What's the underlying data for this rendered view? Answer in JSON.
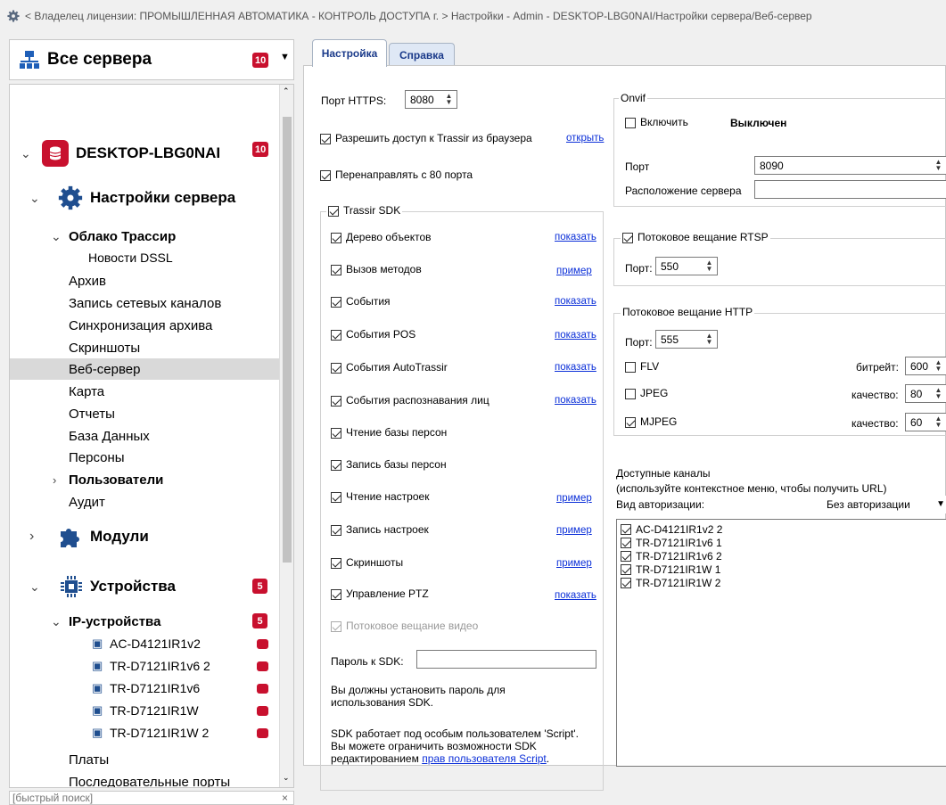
{
  "breadcrumb": "< Владелец лицензии: ПРОМЫШЛЕННАЯ АВТОМАТИКА - КОНТРОЛЬ ДОСТУПА г. > Настройки - Admin - DESKTOP-LBG0NAI/Настройки сервера/Веб-сервер",
  "left": {
    "all_servers": "Все сервера",
    "all_servers_badge": "10",
    "server_name": "DESKTOP-LBG0NAI",
    "server_badge": "10",
    "server_settings": "Настройки сервера",
    "cloud": "Облако Трассир",
    "news": "Новости DSSL",
    "items": [
      "Архив",
      "Запись сетевых каналов",
      "Синхронизация архива",
      "Скриншоты",
      "Веб-сервер",
      "Карта",
      "Отчеты",
      "База Данных",
      "Персоны"
    ],
    "users": "Пользователи",
    "audit": "Аудит",
    "modules": "Модули",
    "devices": "Устройства",
    "devices_badge": "5",
    "ip_devices": "IP-устройства",
    "ip_badge": "5",
    "cameras": [
      "AC-D4121IR1v2",
      "TR-D7121IR1v6 2",
      "TR-D7121IR1v6",
      "TR-D7121IR1W",
      "TR-D7121IR1W 2"
    ],
    "boards": "Платы",
    "serial": "Последовательные порты",
    "search_placeholder": "[быстрый поиск]",
    "search_clear": "×"
  },
  "tabs": {
    "settings": "Настройка",
    "help": "Справка"
  },
  "web": {
    "https_label": "Порт HTTPS:",
    "https_port": "8080",
    "allow_browser": "Разрешить доступ к Trassir из браузера",
    "open_link": "открыть",
    "redirect80": "Перенаправлять с 80 порта",
    "sdk_group": "Trassir SDK",
    "sdk_items": [
      {
        "label": "Дерево объектов",
        "link": "показать",
        "checked": true
      },
      {
        "label": "Вызов методов",
        "link": "пример",
        "checked": true
      },
      {
        "label": "События",
        "link": "показать",
        "checked": true
      },
      {
        "label": "События POS",
        "link": "показать",
        "checked": true
      },
      {
        "label": "События AutoTrassir",
        "link": "показать",
        "checked": true
      },
      {
        "label": "События распознавания лиц",
        "link": "показать",
        "checked": true
      },
      {
        "label": "Чтение базы персон",
        "link": "",
        "checked": true
      },
      {
        "label": "Запись базы персон",
        "link": "",
        "checked": true
      },
      {
        "label": "Чтение настроек",
        "link": "пример",
        "checked": true
      },
      {
        "label": "Запись настроек",
        "link": "пример",
        "checked": true
      },
      {
        "label": "Скриншоты",
        "link": "пример",
        "checked": true
      },
      {
        "label": "Управление PTZ",
        "link": "показать",
        "checked": true
      }
    ],
    "video_stream": "Потоковое вещание видео",
    "sdk_password_label": "Пароль к SDK:",
    "sdk_password_note": "Вы должны установить пароль для использования SDK.",
    "script_note_1": "SDK работает под особым пользователем 'Script'.",
    "script_note_2": "Вы можете ограничить возможности SDK",
    "script_note_3": "редактированием",
    "script_note_link": "прав пользователя Script"
  },
  "onvif": {
    "group": "Onvif",
    "enable": "Включить",
    "status": "Выключен",
    "port_label": "Порт",
    "port": "8090",
    "location_label": "Расположение сервера",
    "location": ""
  },
  "rtsp": {
    "group": "Потоковое вещание RTSP",
    "port_label": "Порт:",
    "port": "550"
  },
  "http": {
    "group": "Потоковое вещание HTTP",
    "port_label": "Порт:",
    "port": "555",
    "formats": [
      {
        "label": "FLV",
        "checked": false,
        "param": "битрейт:",
        "value": "600"
      },
      {
        "label": "JPEG",
        "checked": false,
        "param": "качество:",
        "value": "80"
      },
      {
        "label": "MJPEG",
        "checked": true,
        "param": "качество:",
        "value": "60"
      }
    ]
  },
  "channels": {
    "title": "Доступные каналы",
    "hint": "(используйте контекстное меню, чтобы получить URL)",
    "auth_label": "Вид авторизации:",
    "auth_value": "Без авторизации",
    "list": [
      "AC-D4121IR1v2 2",
      "TR-D7121IR1v6 1",
      "TR-D7121IR1v6 2",
      "TR-D7121IR1W 1",
      "TR-D7121IR1W 2"
    ]
  }
}
